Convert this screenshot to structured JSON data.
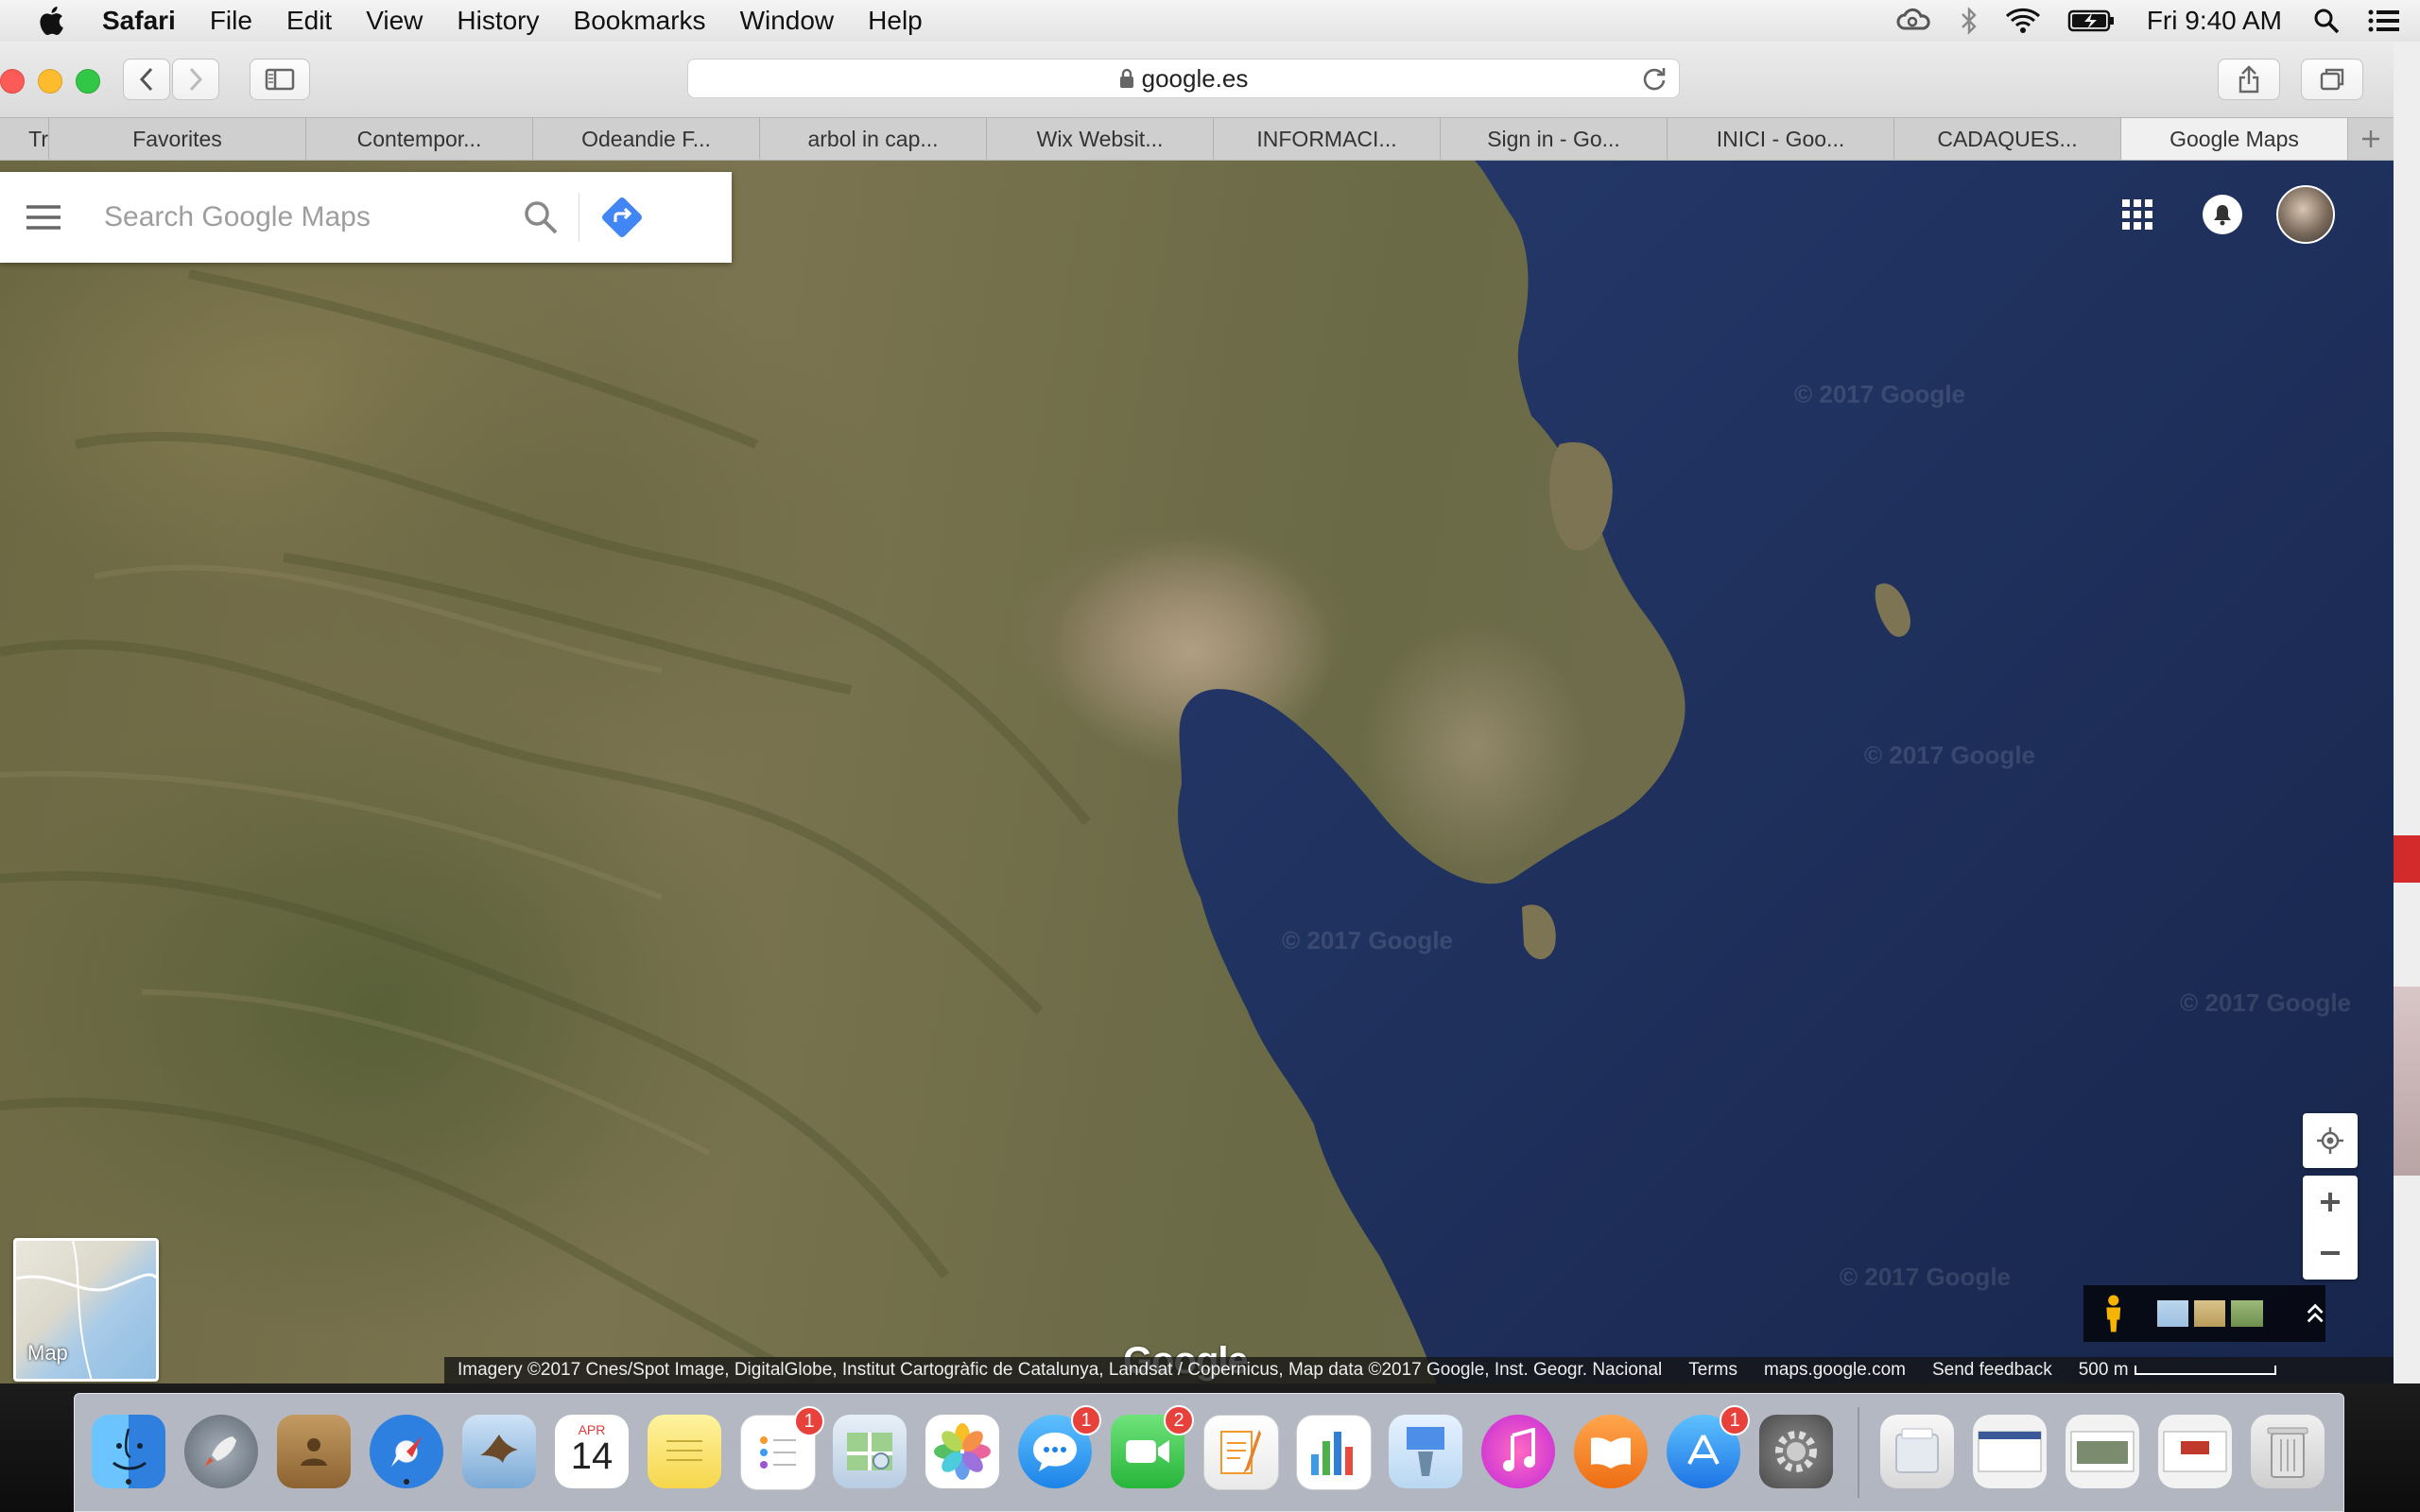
{
  "menubar": {
    "app_name": "Safari",
    "items": [
      "File",
      "Edit",
      "View",
      "History",
      "Bookmarks",
      "Window",
      "Help"
    ],
    "clock": "Fri 9:40 AM",
    "status_icons": [
      "creative-cloud-icon",
      "bluetooth-icon",
      "wifi-icon",
      "battery-icon",
      "spotlight-icon",
      "notification-center-icon"
    ]
  },
  "browser": {
    "url": "google.es",
    "tabs": [
      {
        "label": "Tr"
      },
      {
        "label": "Favorites"
      },
      {
        "label": "Contempor..."
      },
      {
        "label": "Odeandie F..."
      },
      {
        "label": "arbol in cap..."
      },
      {
        "label": "Wix Websit..."
      },
      {
        "label": "INFORMACI..."
      },
      {
        "label": "Sign in - Go..."
      },
      {
        "label": "INICI - Goo..."
      },
      {
        "label": "CADAQUES..."
      },
      {
        "label": "Google Maps",
        "active": true
      }
    ]
  },
  "maps": {
    "search_placeholder": "Search Google Maps",
    "logo": "Google",
    "watermark": "© 2017 Google",
    "map_toggle_label": "Map",
    "footer": {
      "attribution": "Imagery ©2017 Cnes/Spot Image, DigitalGlobe, Institut Cartogràfic de Catalunya, Landsat / Copernicus, Map data ©2017 Google, Inst. Geogr. Nacional",
      "terms": "Terms",
      "site": "maps.google.com",
      "feedback": "Send feedback",
      "scale": "500 m"
    }
  },
  "dock": {
    "calendar_month": "APR",
    "calendar_day": "14",
    "badges": {
      "reminders": "1",
      "messages": "1",
      "facetime": "2",
      "app_store": "1"
    }
  }
}
